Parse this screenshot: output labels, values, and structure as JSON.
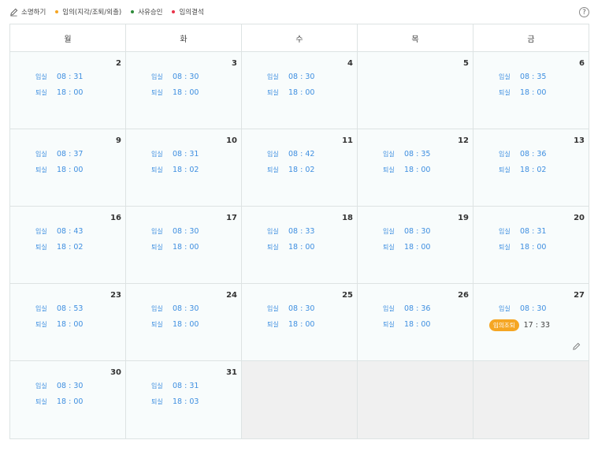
{
  "legend": {
    "edit_label": "소명하기",
    "items": [
      {
        "label": "임의(지각/조퇴/외출)",
        "color": "#f5a623"
      },
      {
        "label": "사유승인",
        "color": "#2e8b3a"
      },
      {
        "label": "임의결석",
        "color": "#e8334a"
      }
    ]
  },
  "help_label": "?",
  "weekdays": [
    "월",
    "화",
    "수",
    "목",
    "금"
  ],
  "in_label": "입실",
  "out_label": "퇴실",
  "early_leave_badge": "임의조퇴",
  "weeks": [
    [
      {
        "day": "2",
        "in": "08 : 31",
        "out": "18 : 00"
      },
      {
        "day": "3",
        "in": "08 : 30",
        "out": "18 : 00"
      },
      {
        "day": "4",
        "in": "08 : 30",
        "out": "18 : 00"
      },
      {
        "day": "5",
        "in": "",
        "out": ""
      },
      {
        "day": "6",
        "in": "08 : 35",
        "out": "18 : 00"
      }
    ],
    [
      {
        "day": "9",
        "in": "08 : 37",
        "out": "18 : 00"
      },
      {
        "day": "10",
        "in": "08 : 31",
        "out": "18 : 02"
      },
      {
        "day": "11",
        "in": "08 : 42",
        "out": "18 : 02"
      },
      {
        "day": "12",
        "in": "08 : 35",
        "out": "18 : 00"
      },
      {
        "day": "13",
        "in": "08 : 36",
        "out": "18 : 02"
      }
    ],
    [
      {
        "day": "16",
        "in": "08 : 43",
        "out": "18 : 02"
      },
      {
        "day": "17",
        "in": "08 : 30",
        "out": "18 : 00"
      },
      {
        "day": "18",
        "in": "08 : 33",
        "out": "18 : 00"
      },
      {
        "day": "19",
        "in": "08 : 30",
        "out": "18 : 00"
      },
      {
        "day": "20",
        "in": "08 : 31",
        "out": "18 : 00"
      }
    ],
    [
      {
        "day": "23",
        "in": "08 : 53",
        "out": "18 : 00"
      },
      {
        "day": "24",
        "in": "08 : 30",
        "out": "18 : 00"
      },
      {
        "day": "25",
        "in": "08 : 30",
        "out": "18 : 00"
      },
      {
        "day": "26",
        "in": "08 : 36",
        "out": "18 : 00"
      },
      {
        "day": "27",
        "in": "08 : 30",
        "out": "17 : 33",
        "early_leave": true
      }
    ],
    [
      {
        "day": "30",
        "in": "08 : 30",
        "out": "18 : 00"
      },
      {
        "day": "31",
        "in": "08 : 31",
        "out": "18 : 03"
      },
      {
        "day": "",
        "in": "",
        "out": "",
        "empty": true
      },
      {
        "day": "",
        "in": "",
        "out": "",
        "empty": true
      },
      {
        "day": "",
        "in": "",
        "out": "",
        "empty": true
      }
    ]
  ]
}
